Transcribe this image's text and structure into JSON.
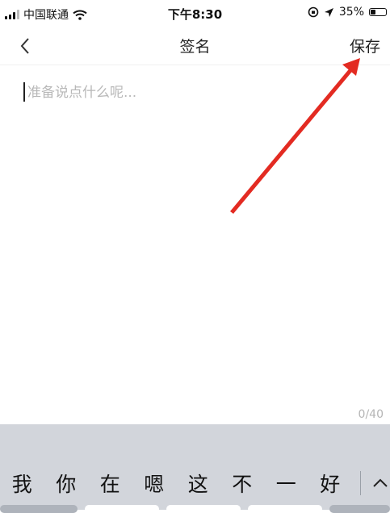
{
  "status_bar": {
    "carrier": "中国联通",
    "time": "下午8:30",
    "battery": "35%",
    "battery_level": 0.35
  },
  "nav": {
    "title": "签名",
    "save_label": "保存",
    "back_icon": "chevron-left-icon"
  },
  "editor": {
    "placeholder": "准备说点什么呢...",
    "value": "",
    "counter": "0/40"
  },
  "keyboard": {
    "candidates": [
      "我",
      "你",
      "在",
      "嗯",
      "这",
      "不",
      "一",
      "好"
    ],
    "expand_icon": "chevron-up-icon"
  },
  "annotation": {
    "arrow_color": "#e32b22"
  }
}
